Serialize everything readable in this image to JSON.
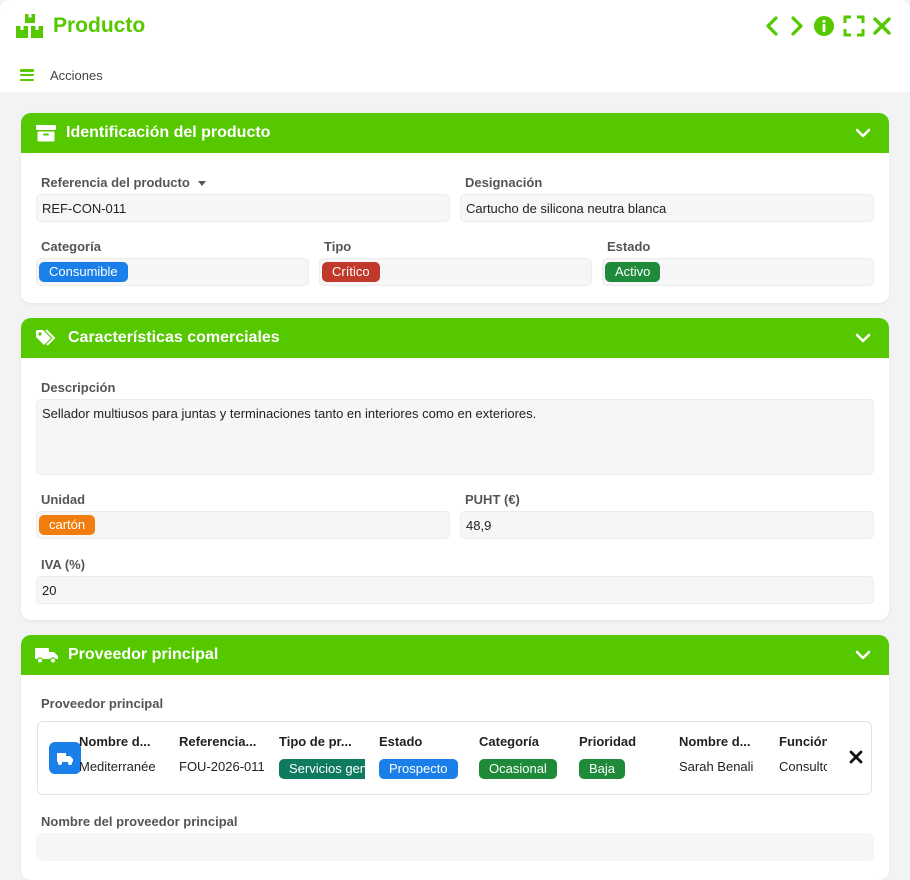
{
  "window": {
    "title": "Producto",
    "actions_label": "Acciones",
    "accent_color": "#55c800"
  },
  "toolbar_icons": [
    "chevron-left-icon",
    "chevron-right-icon",
    "info-icon",
    "fullscreen-icon",
    "close-icon"
  ],
  "identification": {
    "title": "Identificación del producto",
    "reference_label": "Referencia del producto",
    "reference_value": "REF-CON-011",
    "designation_label": "Designación",
    "designation_value": "Cartucho de silicona neutra blanca",
    "category_label": "Categoría",
    "category_value": "Consumible",
    "category_color": "#1a7fe8",
    "type_label": "Tipo",
    "type_value": "Crítico",
    "type_color": "#c0392b",
    "status_label": "Estado",
    "status_value": "Activo",
    "status_color": "#1e8a3a"
  },
  "commercial": {
    "title": "Características comerciales",
    "description_label": "Descripción",
    "description_value": "Sellador multiusos para juntas y terminaciones tanto en interiores como en exteriores.",
    "unit_label": "Unidad",
    "unit_value": "cartón",
    "unit_color": "#f07d0e",
    "puht_label": "PUHT (€)",
    "puht_value": "48,9",
    "vat_label": "IVA (%)",
    "vat_value": "20"
  },
  "supplier": {
    "title": "Proveedor principal",
    "field_label": "Proveedor principal",
    "columns": [
      {
        "header": "Nombre d...",
        "value": "Mediterranée"
      },
      {
        "header": "Referencia...",
        "value": "FOU-2026-011"
      },
      {
        "header": "Tipo de pr...",
        "value": "Servicios generales",
        "badge_color": "#0e7a5f"
      },
      {
        "header": "Estado",
        "value": "Prospecto",
        "badge_color": "#1a7fe8"
      },
      {
        "header": "Categoría",
        "value": "Ocasional",
        "badge_color": "#1e8a3a"
      },
      {
        "header": "Prioridad",
        "value": "Baja",
        "badge_color": "#1e8a3a"
      },
      {
        "header": "Nombre d...",
        "value": "Sarah Benali"
      },
      {
        "header": "Función",
        "value": "Consultor"
      }
    ],
    "name_label": "Nombre del proveedor principal",
    "name_value": ""
  }
}
